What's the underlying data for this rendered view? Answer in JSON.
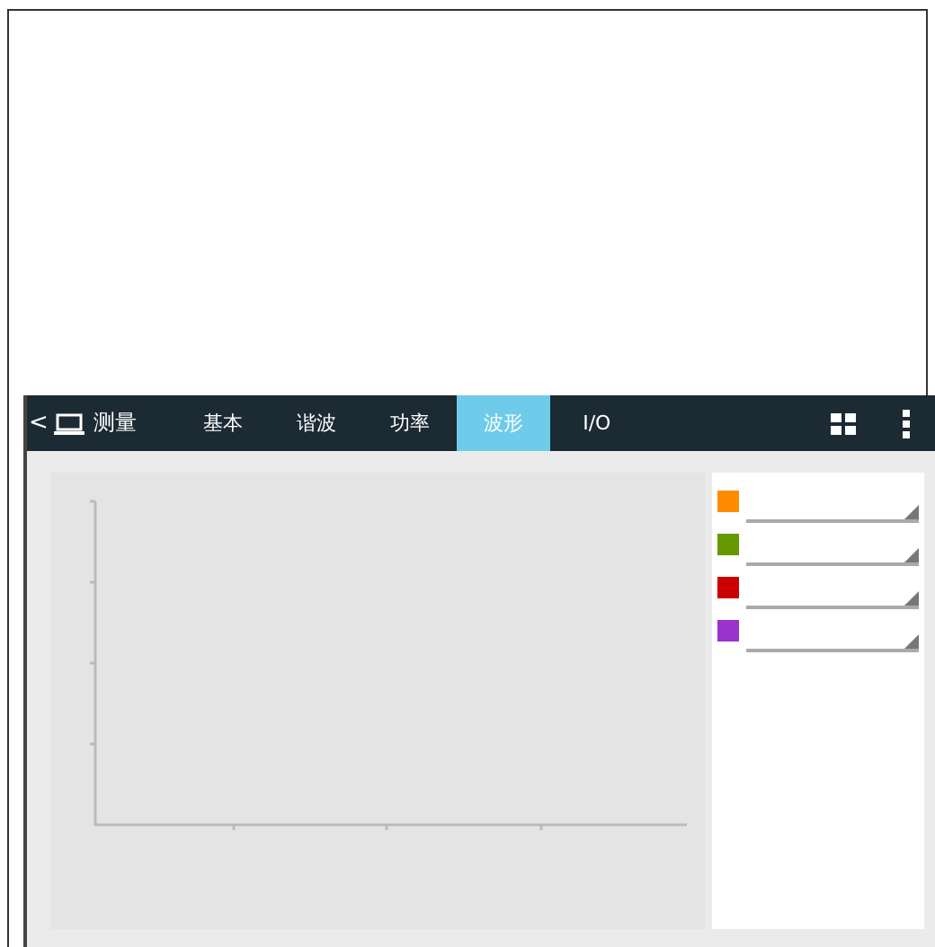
{
  "toolbar": {
    "back": "<",
    "title": "测量"
  },
  "tabs": [
    {
      "label": "基本",
      "selected": false
    },
    {
      "label": "谐波",
      "selected": false
    },
    {
      "label": "功率",
      "selected": false
    },
    {
      "label": "波形",
      "selected": true
    },
    {
      "label": "I/O",
      "selected": false
    }
  ],
  "legend": [
    {
      "color": "#ff8c00"
    },
    {
      "color": "#669900"
    },
    {
      "color": "#cc0000"
    },
    {
      "color": "#9933cc"
    }
  ]
}
